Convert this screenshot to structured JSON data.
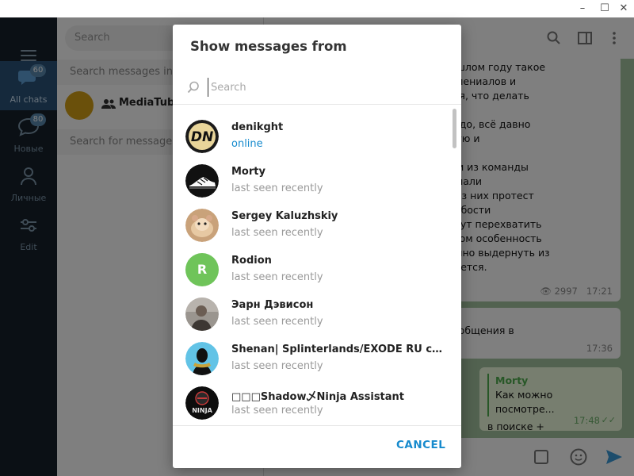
{
  "window": {
    "min": "–",
    "max": "☐",
    "close": "✕"
  },
  "sidebar": {
    "folders": [
      {
        "label": "All chats",
        "badge": "60"
      },
      {
        "label": "Новые",
        "badge": "80"
      },
      {
        "label": "Личные"
      },
      {
        "label": "Edit"
      }
    ]
  },
  "chatlist": {
    "search_placeholder": "Search",
    "search_in": "Search messages in",
    "chat_name": "MediaTube",
    "search_for": "Search for messages"
  },
  "chat": {
    "msg1_lines": [
      "групп. В прошлом году такое",
      "группки миллениалов и",
      "м, не понимая, что делать",
      "",
      "осипед не надо, всё давно",
      "организующую и",
      "",
      "ые чиновники из команды",
      "рочь передумали",
      "протест. И без них протест",
      "ворит и о слабости",
      "торые не могут перехватить",
      "юдей). И в этом особенность",
      "на – достаточно выдернуть из",
      "он разваливается."
    ],
    "msg1_views": "2997",
    "msg1_time": "17:21",
    "msg2_line": "у все свои сообщения в",
    "msg2_time": "17:36",
    "reply_name": "Morty",
    "reply_text": "Как можно посмотре...",
    "msg3_text": "в поиске +",
    "msg3_time": "17:48"
  },
  "modal": {
    "title": "Show messages from",
    "search_placeholder": "Search",
    "cancel_label": "CANCEL",
    "users": [
      {
        "name": "denikght",
        "status": "online",
        "online": true,
        "avatar": "dn-logo"
      },
      {
        "name": "Morty",
        "status": "last seen recently",
        "online": false,
        "avatar": "sneaker"
      },
      {
        "name": "Sergey Kaluzhskiy",
        "status": "last seen recently",
        "online": false,
        "avatar": "hamster"
      },
      {
        "name": "Rodion",
        "status": "last seen recently",
        "online": false,
        "avatar": "letter-r",
        "initial": "R",
        "color": "#6fc45a"
      },
      {
        "name": "Эарн Дэвисон",
        "status": "last seen recently",
        "online": false,
        "avatar": "person"
      },
      {
        "name": "Shenan| Splinterlands/EXODE RU commu...",
        "status": "last seen recently",
        "online": false,
        "avatar": "warrior"
      },
      {
        "name": "□□□Shadow乄Ninja Assistant",
        "status": "last seen recently",
        "online": false,
        "avatar": "ninja"
      }
    ]
  },
  "colors": {
    "accent": "#168acd",
    "online": "#168acd",
    "sidebar": "#17212b",
    "chat_bg": "#a5c4a1"
  }
}
